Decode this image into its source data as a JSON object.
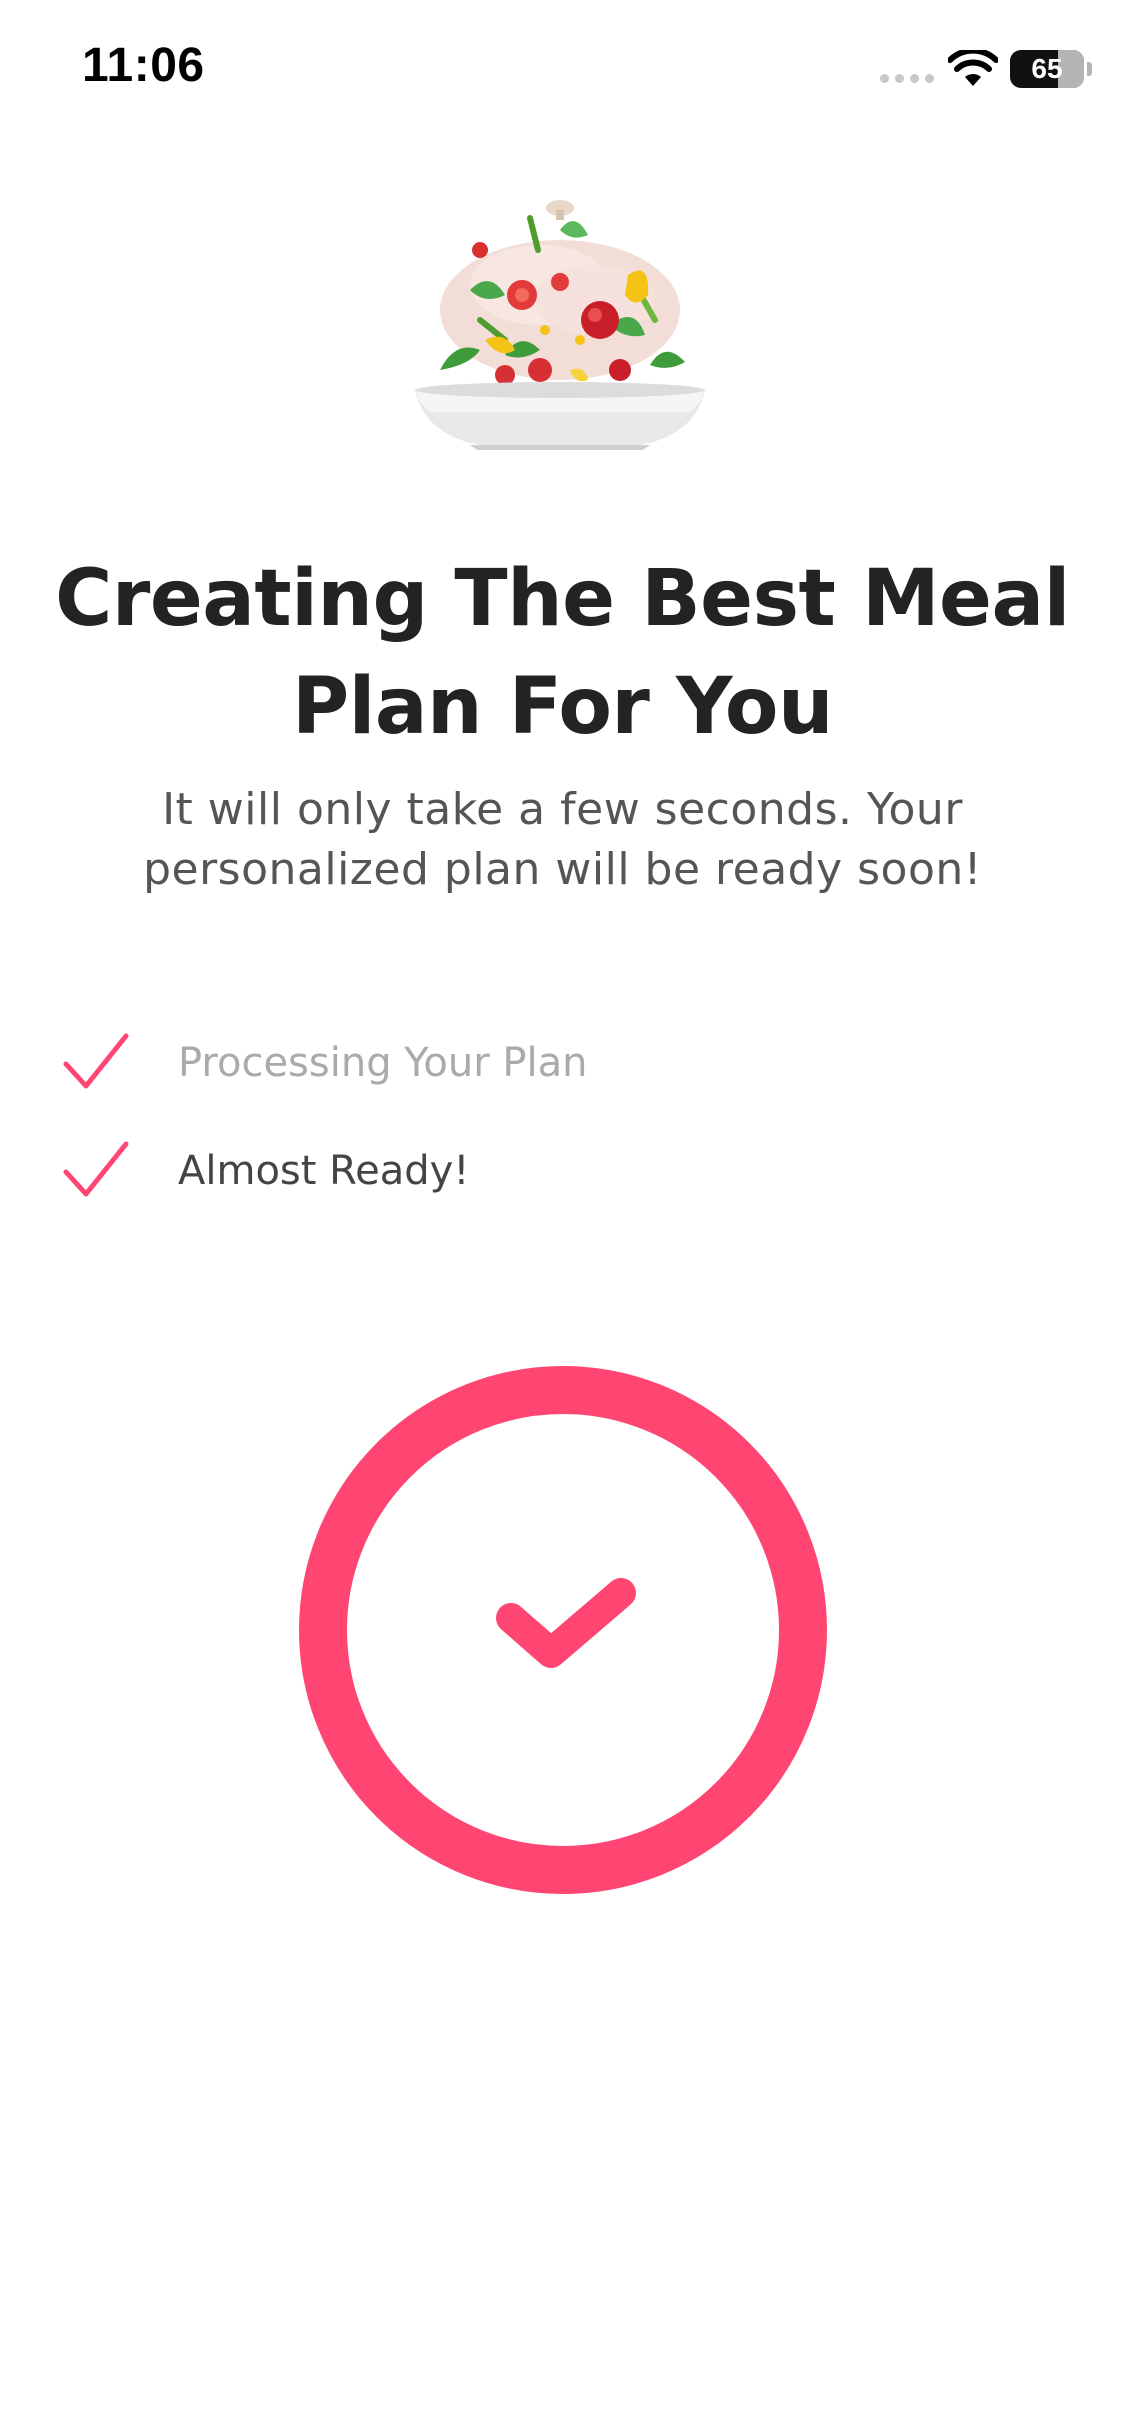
{
  "status_bar": {
    "time": "11:06",
    "battery": "65"
  },
  "colors": {
    "accent": "#ff4672",
    "title": "#232323",
    "subtitle": "#555555",
    "step_done": "#aaaaaa",
    "step_active": "#444444"
  },
  "illustration": {
    "icon": "salad-bowl-icon"
  },
  "header": {
    "title": "Creating The Best Meal Plan For You",
    "subtitle": "It will only take a few seconds. Your personalized plan will be ready soon!"
  },
  "steps": [
    {
      "label": "Processing Your Plan",
      "icon": "checkmark-icon",
      "state": "done"
    },
    {
      "label": "Almost Ready!",
      "icon": "checkmark-icon",
      "state": "active"
    }
  ],
  "completion": {
    "icon": "circle-check-icon"
  }
}
